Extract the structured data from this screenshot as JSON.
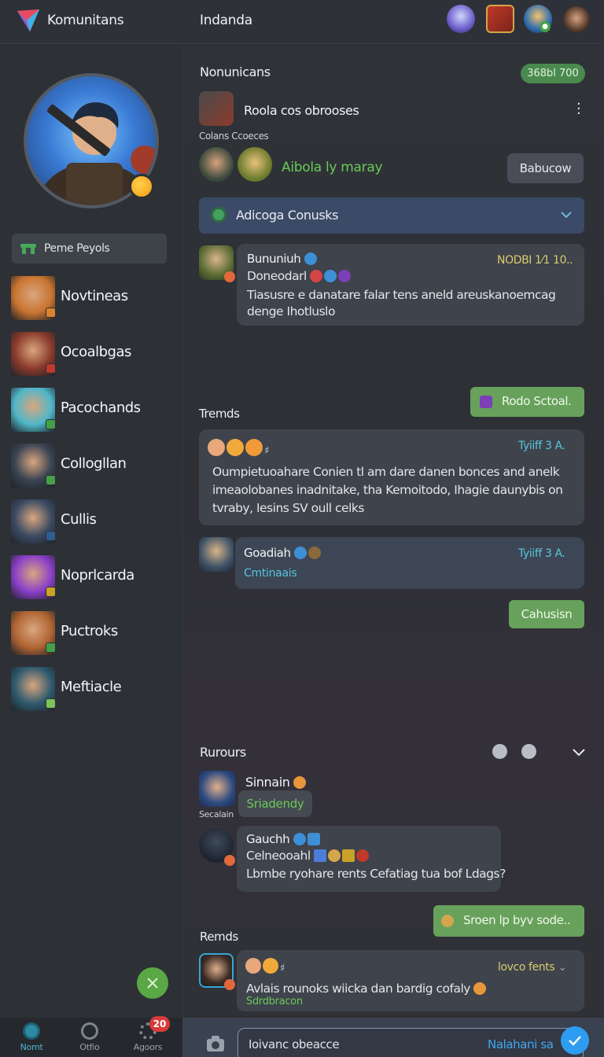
{
  "header": {
    "app_title": "Komunitans",
    "page_title": "Indanda"
  },
  "sidebar": {
    "search_label": "Peme Peyols",
    "friends": [
      {
        "name": "Novtineas",
        "badge_color": "#d9832e",
        "avatar_color": "#c9742f"
      },
      {
        "name": "Ocoalbgas",
        "badge_color": "#c0392b",
        "avatar_color": "#8a3a2c"
      },
      {
        "name": "Pacochands",
        "badge_color": "#43a047",
        "avatar_color": "#4fb7c9"
      },
      {
        "name": "Collogllan",
        "badge_color": "#43a047",
        "avatar_color": "#3a4452"
      },
      {
        "name": "Cullis",
        "badge_color": "#2e5d8f",
        "avatar_color": "#3b4a62"
      },
      {
        "name": "Noprlcarda",
        "badge_color": "#c9a227",
        "avatar_color": "#8a3fc9"
      },
      {
        "name": "Puctroks",
        "badge_color": "#43a047",
        "avatar_color": "#b06433"
      },
      {
        "name": "Meftiacle",
        "badge_color": "#7cc35a",
        "avatar_color": "#2f5a6e"
      }
    ]
  },
  "bottom_nav": {
    "items": [
      {
        "label": "Nomt"
      },
      {
        "label": "Otfio"
      },
      {
        "label": "Agoors"
      }
    ],
    "badge": "20"
  },
  "main": {
    "section1": {
      "title": "Nonunicans",
      "pill": "368bl 700"
    },
    "post1": {
      "title": "Roola cos obrooses",
      "caption": "Colans Ccoeces"
    },
    "group": {
      "text": "Aibola ly maray",
      "button": "Babucow"
    },
    "dropdown": {
      "label": "Adicoga Conusks"
    },
    "msg1": {
      "name": "Bununiuh",
      "sub": "Doneodarl",
      "time": "NODBI 1⁄1 10..",
      "text": "Tiasusre e danatare falar tens aneld areuskanoemcag denge Ihotluslo"
    },
    "green1": "Rodo Sctoal.",
    "section2": {
      "title": "Tremds"
    },
    "msg2": {
      "time": "Tyiiff 3 A.",
      "text": "Oumpietuoahare Conien tl am dare danen bonces and anelk imeaolobanes inadnitake, tha Kemoitodo, Ihagie daunybis on tvraby, Iesins SV oull celks"
    },
    "msg3": {
      "name": "Goadiah",
      "time": "Tyiiff 3 A.",
      "link": "Cmtinaais"
    },
    "green2": "Cahusisn",
    "section3": {
      "title": "Rurours"
    },
    "msg4": {
      "name": "Sinnain",
      "reply": "Sriadendy",
      "label": "Secalain"
    },
    "msg5": {
      "name": "Gauchh",
      "sub": "Celneooahl",
      "text": "Lbmbe ryohare rents Cefatiag tua bof Ldags?"
    },
    "green3": "Sroen lp byv sode..",
    "section4": {
      "title": "Remds"
    },
    "msg6": {
      "time": "lovco fents",
      "text": "Avlais rounoks wiicka dan bardig cofaly",
      "link": "Sdrdbracon"
    }
  },
  "composer": {
    "placeholder": "Ioivanc obeacce",
    "action": "Nalahani sa"
  },
  "colors": {
    "accent_green": "#67a15b",
    "accent_blue": "#2e9cf0",
    "time_yellow": "#d9cc6e"
  }
}
